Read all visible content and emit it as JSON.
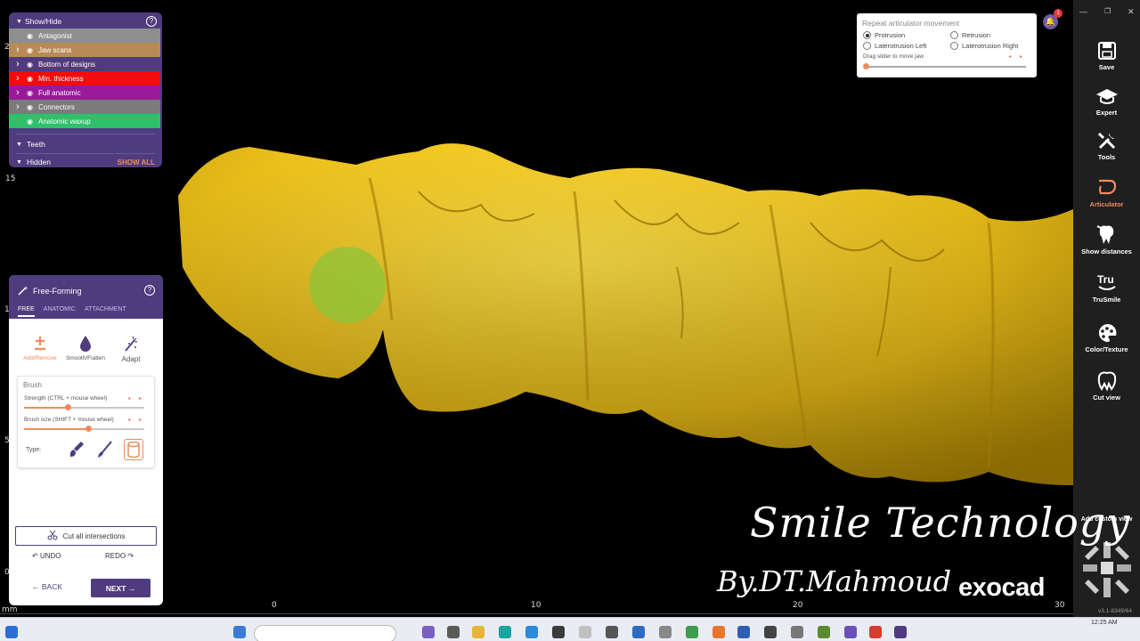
{
  "show_hide": {
    "title": "Show/Hide",
    "items": [
      {
        "label": "Antagonist",
        "bg": "#8e8e8e",
        "chev": false
      },
      {
        "label": "Jaw scans",
        "bg": "#b88a57",
        "chev": true
      },
      {
        "label": "Bottom of designs",
        "bg": "#4e3c7e",
        "chev": true
      },
      {
        "label": "Min. thickness",
        "bg": "#f20c0c",
        "chev": true
      },
      {
        "label": "Full anatomic",
        "bg": "#9a1a9a",
        "chev": true
      },
      {
        "label": "Connectors",
        "bg": "#7b7b7b",
        "chev": true
      },
      {
        "label": "Anatomic waxup",
        "bg": "#2fc06a",
        "chev": false
      }
    ],
    "teeth": "Teeth",
    "hidden": "Hidden",
    "show_all": "SHOW ALL"
  },
  "free_forming": {
    "title": "Free-Forming",
    "tabs": [
      "FREE",
      "ANATOMIC",
      "ATTACHMENT"
    ],
    "tools": [
      "Add/Remove",
      "Smooth/Flatten",
      "Adapt"
    ],
    "brush_title": "Brush",
    "strength_label": "Strength (CTRL + mouse wheel)",
    "strength_value": 0.36,
    "size_label": "Brush size (SHIFT + mouse wheel)",
    "size_value": 0.53,
    "type_label": "Type:",
    "cut_label": "Cut all intersections",
    "undo": "UNDO",
    "redo": "REDO",
    "back": "BACK",
    "next": "NEXT"
  },
  "articulator": {
    "title": "Repeat articulator movement",
    "options": [
      "Protrusion",
      "Retrusion",
      "Laterotrusion Left",
      "Laterotrusion Right"
    ],
    "selected": "Protrusion",
    "drag_label": "Drag slider to move jaw"
  },
  "notification_count": "1",
  "toolbar": {
    "items": [
      "Save",
      "Expert",
      "Tools",
      "Articulator",
      "Show distances",
      "TruSmile",
      "Color/Texture",
      "Cut view"
    ],
    "active": "Articulator",
    "add_custom_view": "Add custom view",
    "version": "v3.1-8349/64"
  },
  "ruler": {
    "unit": "mm",
    "x_ticks": [
      "0",
      "10",
      "20",
      "30"
    ],
    "y_ticks": [
      "2",
      "15",
      "1",
      "5",
      "0"
    ]
  },
  "watermark": {
    "line1": "Smile Technology",
    "line2": "By.DT.Mahmoud",
    "brand": "exocad"
  },
  "taskbar": {
    "time": "12:25 AM"
  },
  "colors": {
    "accent": "#4e3c7e",
    "orange": "#f08a5d",
    "tooth": "#f2c61c"
  }
}
